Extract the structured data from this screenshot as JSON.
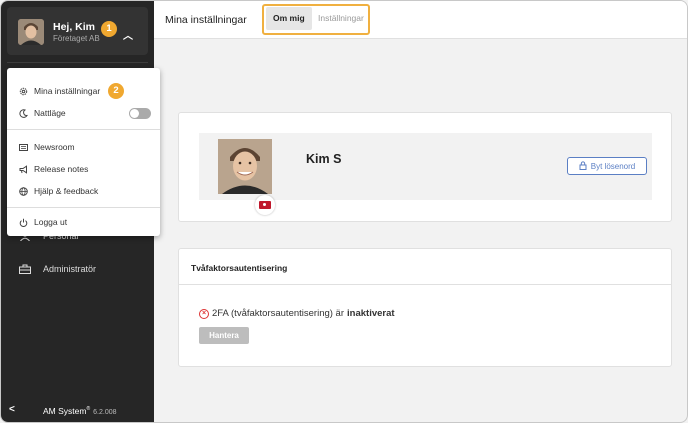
{
  "user": {
    "greeting": "Hej, Kim",
    "company": "Företaget AB"
  },
  "markers": {
    "first": "1",
    "second": "2"
  },
  "menu": {
    "my_settings": "Mina inställningar",
    "night_mode": "Nattläge",
    "newsroom": "Newsroom",
    "release_notes": "Release notes",
    "help": "Hjälp & feedback",
    "logout": "Logga ut"
  },
  "sidebar": {
    "items": [
      {
        "label": "Personal",
        "icon": "person-icon"
      },
      {
        "label": "Administratör",
        "icon": "toolbox-icon"
      }
    ],
    "brand": "AM System",
    "brand_mark": "®",
    "version": "6.2.008"
  },
  "header": {
    "title": "Mina inställningar",
    "tabs": [
      {
        "label": "Om mig",
        "active": true
      },
      {
        "label": "Inställningar",
        "active": false
      }
    ]
  },
  "profile": {
    "name": "Kim S",
    "change_password_label": "Byt lösenord"
  },
  "twofa": {
    "title": "Tvåfaktorsautentisering",
    "status_prefix": "2FA (tvåfaktorsautentisering) är",
    "status_value": "inaktiverat",
    "manage_label": "Hantera"
  },
  "colors": {
    "sidebar_bg": "#262626",
    "marker": "#f0a830",
    "tab_highlight": "#f0b040",
    "link_blue": "#5b7fc4",
    "error_red": "#d33"
  }
}
